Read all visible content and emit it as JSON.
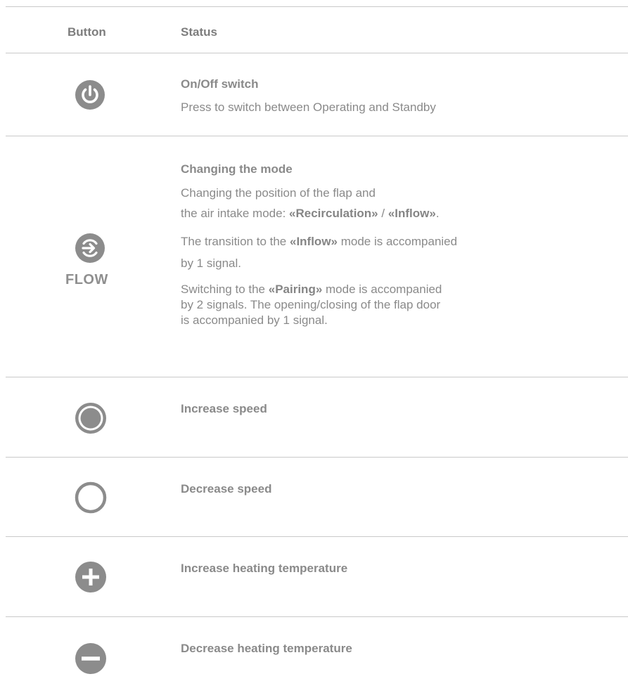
{
  "header": {
    "button_col": "Button",
    "status_col": "Status"
  },
  "rows": [
    {
      "icon": "power-icon",
      "title": "On/Off switch",
      "lines": [
        "Press to switch between Operating and Standby"
      ]
    },
    {
      "icon": "flow-mode-icon",
      "icon_label": "FLOW",
      "title": "Changing the mode",
      "p1_line1": "Changing the position of the flap and",
      "p1_line2_pre": "the air intake mode: ",
      "p1_recirc": "«Recirculation»",
      "p1_sep": " / ",
      "p1_inflow": "«Inflow»",
      "p1_end": ".",
      "p2_pre": "The transition to the ",
      "p2_inflow": "«Inflow»",
      "p2_post": " mode is accompanied",
      "p2_line2": "by 1 signal.",
      "p3_pre": "Switching to the ",
      "p3_pairing": "«Pairing»",
      "p3_post": " mode is accompanied",
      "p3_line2": "by 2 signals. The opening/closing of the flap door",
      "p3_line3": "is accompanied by 1 signal."
    },
    {
      "icon": "filled-circle-icon",
      "title": "Increase speed"
    },
    {
      "icon": "empty-circle-icon",
      "title": "Decrease speed"
    },
    {
      "icon": "plus-icon",
      "title": "Increase heating temperature"
    },
    {
      "icon": "minus-icon",
      "title": "Decrease heating temperature"
    }
  ],
  "colors": {
    "icon": "#8c8c8c",
    "divider": "#c9c9c9",
    "text": "#8a8a8a"
  }
}
